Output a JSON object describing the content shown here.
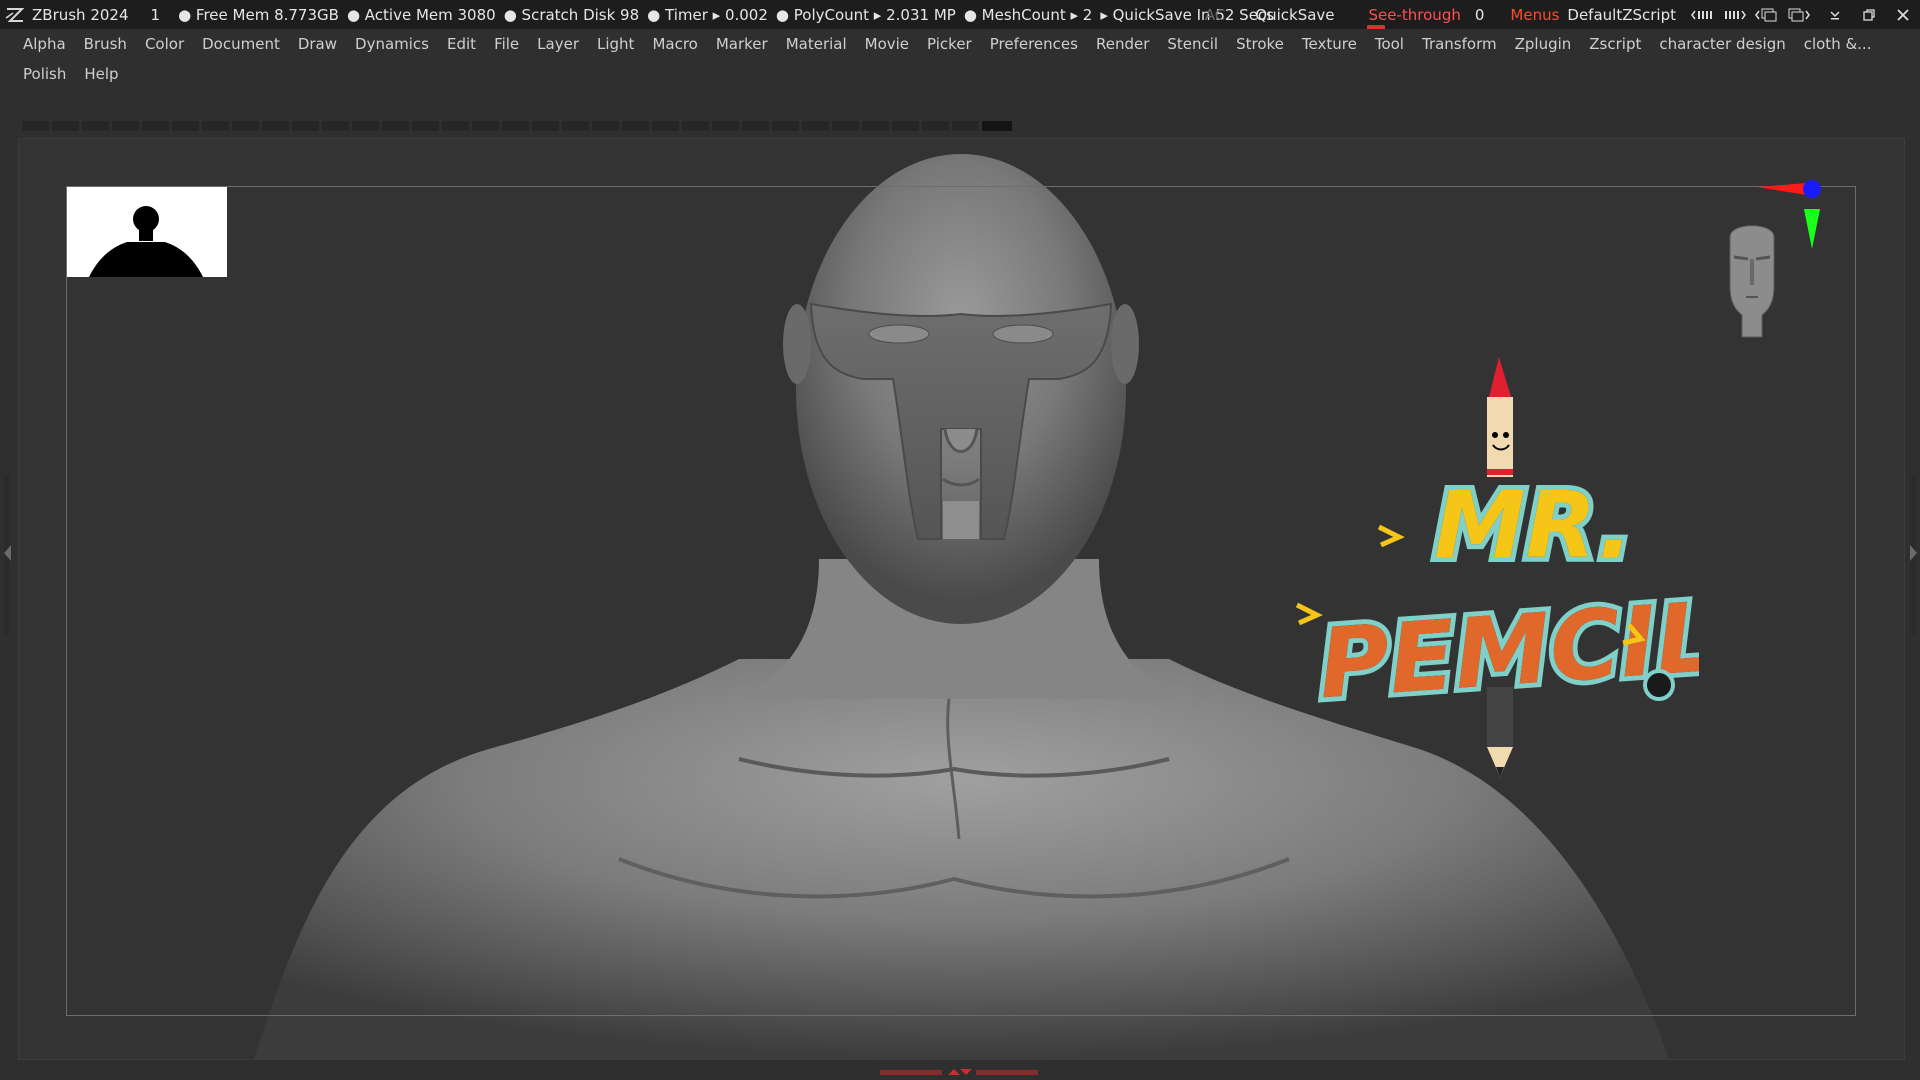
{
  "titlebar": {
    "app_name": "ZBrush 2024",
    "doc_index": "1",
    "stats": [
      "● Free Mem 8.773GB",
      "● Active Mem 3080",
      "● Scratch Disk 98",
      "● Timer ▸ 0.002",
      "● PolyCount ▸ 2.031 MP",
      "● MeshCount ▸ 2",
      "▸ QuickSave In 52 Secs"
    ],
    "ac_label": "AC",
    "quicksave_label": "QuickSave",
    "seethrough_label": "See-through",
    "seethrough_value": "0",
    "menus_label": "Menus",
    "script_label": "DefaultZScript",
    "accent_color": "#ff4a2a"
  },
  "menubar": {
    "items": [
      "Alpha",
      "Brush",
      "Color",
      "Document",
      "Draw",
      "Dynamics",
      "Edit",
      "File",
      "Layer",
      "Light",
      "Macro",
      "Marker",
      "Material",
      "Movie",
      "Picker",
      "Preferences",
      "Render",
      "Stencil",
      "Stroke",
      "Texture",
      "Tool",
      "Transform",
      "Zplugin",
      "Zscript",
      "character design",
      "cloth &...",
      "Polish",
      "Help"
    ]
  },
  "viewport": {
    "thumbnail_icon": "silhouette-thumbnail",
    "gizmo_icon": "axis-gizmo-icon",
    "navigator_icon": "head-navigator-icon",
    "model_icon": "sculpt-bust-model",
    "axis_colors": {
      "x": "#ff1a1a",
      "y": "#1aff1a",
      "z": "#1a1aff"
    }
  },
  "logo": {
    "line1": "MR.",
    "line2": "PEMCIL"
  }
}
